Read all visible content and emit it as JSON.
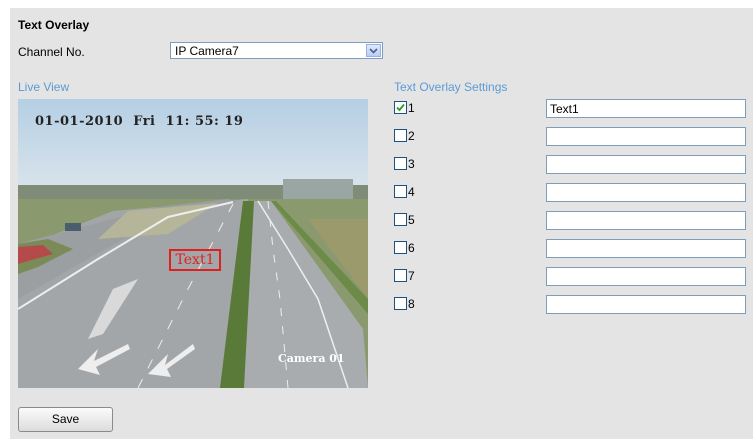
{
  "section_title": "Text Overlay",
  "channel": {
    "label": "Channel No.",
    "selected": "IP Camera7",
    "icon": "chevron-down-icon"
  },
  "live_view": {
    "label": "Live View",
    "osd_date": "01-01-2010  Fri  11: 55: 19",
    "osd_text": "Text1",
    "osd_camera": "Camera 01"
  },
  "settings": {
    "label": "Text Overlay Settings",
    "rows": [
      {
        "label": "1",
        "checked": true,
        "value": "Text1"
      },
      {
        "label": "2",
        "checked": false,
        "value": ""
      },
      {
        "label": "3",
        "checked": false,
        "value": ""
      },
      {
        "label": "4",
        "checked": false,
        "value": ""
      },
      {
        "label": "5",
        "checked": false,
        "value": ""
      },
      {
        "label": "6",
        "checked": false,
        "value": ""
      },
      {
        "label": "7",
        "checked": false,
        "value": ""
      },
      {
        "label": "8",
        "checked": false,
        "value": ""
      }
    ]
  },
  "save_label": "Save",
  "colors": {
    "section_label": "#5b9bd5",
    "panel_bg": "#e4e4e4",
    "overlay_box": "#e02020"
  }
}
